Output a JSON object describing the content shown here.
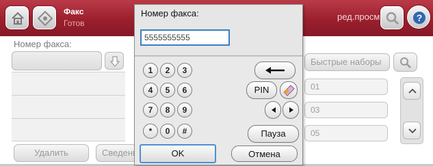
{
  "header": {
    "app_title": "Факс",
    "app_status": "Готов",
    "edit_view_label": "ред.просм.",
    "icons": [
      "home-icon",
      "fax-app-icon",
      "search-icon",
      "help-icon"
    ]
  },
  "background": {
    "fax_number_label": "Номер факса:",
    "speed_dials_label": "Быстрые наборы",
    "speed_dial_items": [
      "01",
      "03",
      "05"
    ],
    "delete_label": "Удалить",
    "svodka_label": "Сведения"
  },
  "dialog": {
    "title": "Номер факса:",
    "fax_number_value": "5555555555",
    "keys": [
      "1",
      "2",
      "3",
      "4",
      "5",
      "6",
      "7",
      "8",
      "9",
      "*",
      "0",
      "#"
    ],
    "pin_label": "PIN",
    "pause_label": "Пауза",
    "ok_label": "OK",
    "cancel_label": "Отмена",
    "icons": [
      "backspace-arrow-icon",
      "eraser-icon",
      "left-arrow-icon",
      "right-arrow-icon"
    ]
  },
  "colors": {
    "header_red": "#9b1f2d",
    "focus_blue": "#3b7fc4",
    "dialog_gray": "#cdcdcd"
  }
}
